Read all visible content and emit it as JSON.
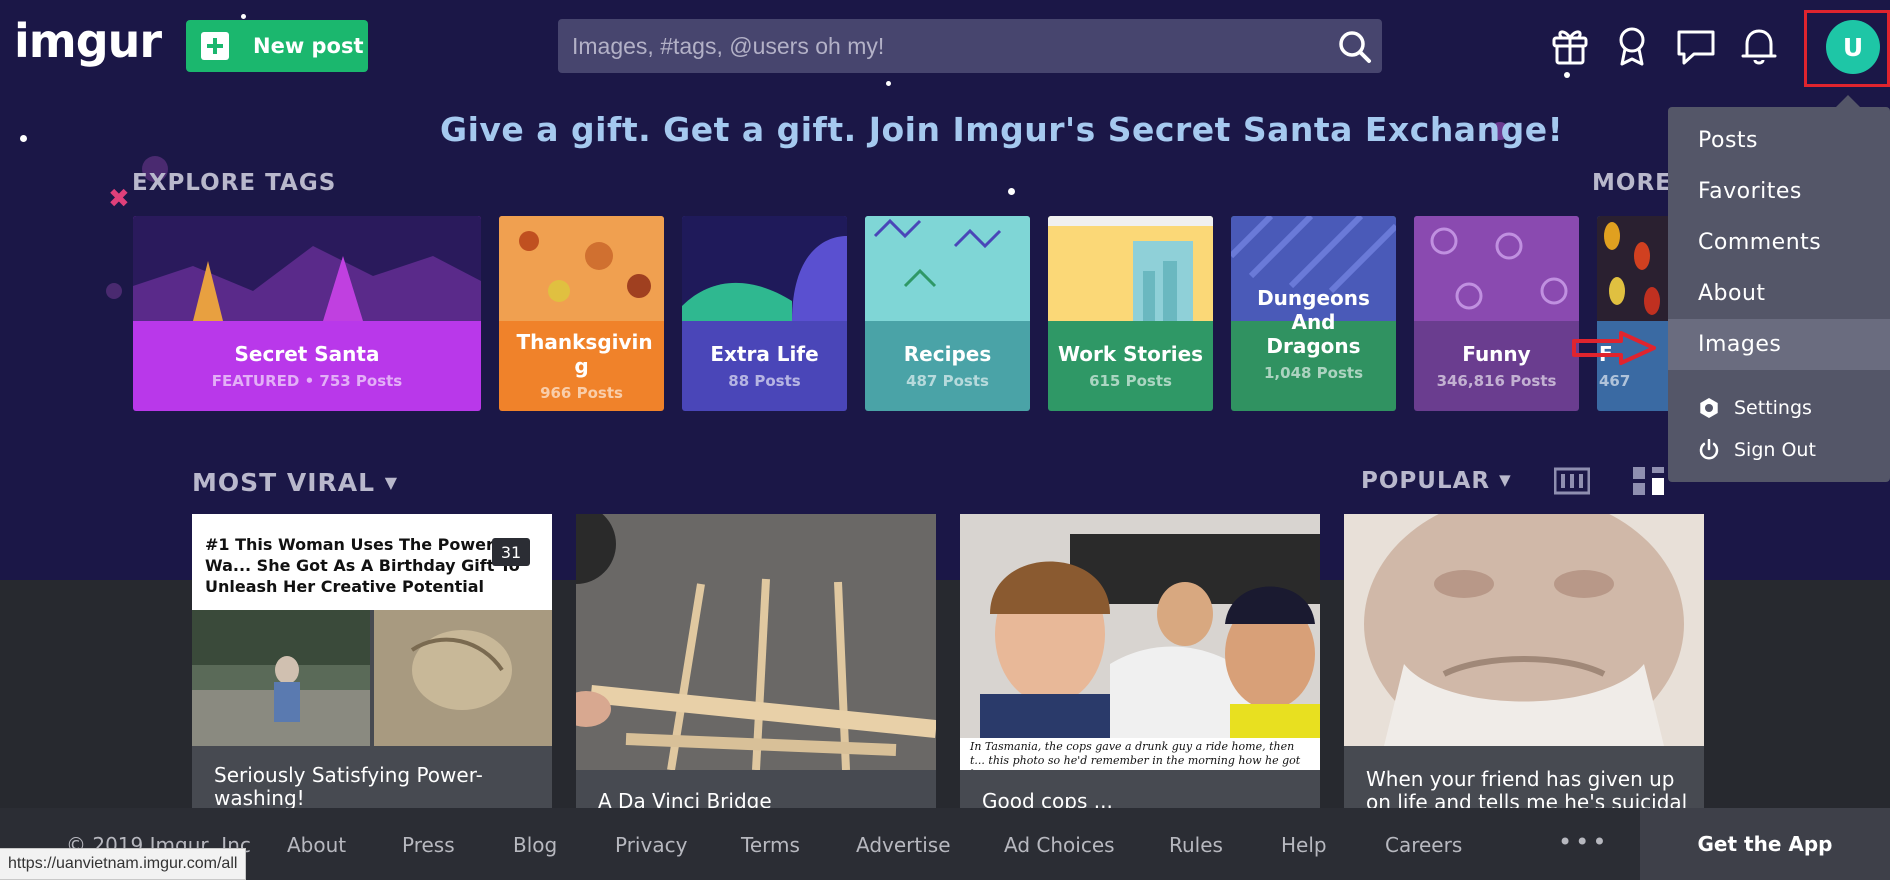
{
  "header": {
    "logo": "imgur",
    "new_post_label": "New post",
    "search_placeholder": "Images, #tags, @users oh my!",
    "avatar_letter": "U"
  },
  "banner": "Give a gift. Get a gift. Join Imgur's Secret Santa Exchange!",
  "explore": {
    "label": "EXPLORE TAGS",
    "more_label": "MORE",
    "tags": [
      {
        "name": "Secret Santa",
        "count": "FEATURED • 753 Posts",
        "color": "#b938ea"
      },
      {
        "name": "Thanksgivin g",
        "count": "966 Posts",
        "color": "#f0822a"
      },
      {
        "name": "Extra Life",
        "count": "88 Posts",
        "color": "#4a46b8"
      },
      {
        "name": "Recipes",
        "count": "487 Posts",
        "color": "#4aa3a7"
      },
      {
        "name": "Work Stories",
        "count": "615 Posts",
        "color": "#2f9866"
      },
      {
        "name": "Dungeons And Dragons",
        "count": "1,048 Posts",
        "color": "#309261"
      },
      {
        "name": "Funny",
        "count": "346,816 Posts",
        "color": "#6a3d8f"
      },
      {
        "name": "F",
        "count": "467",
        "color": "#3a6aa3"
      }
    ]
  },
  "dropdown": {
    "items": [
      "Posts",
      "Favorites",
      "Comments",
      "About",
      "Images"
    ],
    "active": "Images",
    "settings_label": "Settings",
    "signout_label": "Sign Out"
  },
  "gallery": {
    "sort_label": "MOST VIRAL",
    "filter_label": "POPULAR",
    "cards": [
      {
        "header": "#1 This Woman Uses The Power Wa... She Got As A Birthday Gift To Unleash Her Creative Potential",
        "badge": "31",
        "title": "Seriously Satisfying Power-washing!"
      },
      {
        "title": "A Da Vinci Bridge"
      },
      {
        "caption": "In Tasmania, the cops gave a drunk guy a ride home, then t... this photo so he'd remember in the morning how he got hom...",
        "title": "Good cops ..."
      },
      {
        "title": "When your friend has given up on life and tells me he's suicidal an..."
      }
    ]
  },
  "footer": {
    "copyright": "© 2019 Imgur, Inc",
    "links": [
      "About",
      "Press",
      "Blog",
      "Privacy",
      "Terms",
      "Advertise",
      "Ad Choices",
      "Rules",
      "Help",
      "Careers"
    ],
    "more": "•••",
    "get_app": "Get the App"
  },
  "status_url": "https://uanvietnam.imgur.com/all",
  "colors": {
    "background": "#1b1747",
    "new_post_green": "#1bb76e",
    "highlight_red": "#e0242e",
    "banner_text": "#a5c9ef"
  }
}
